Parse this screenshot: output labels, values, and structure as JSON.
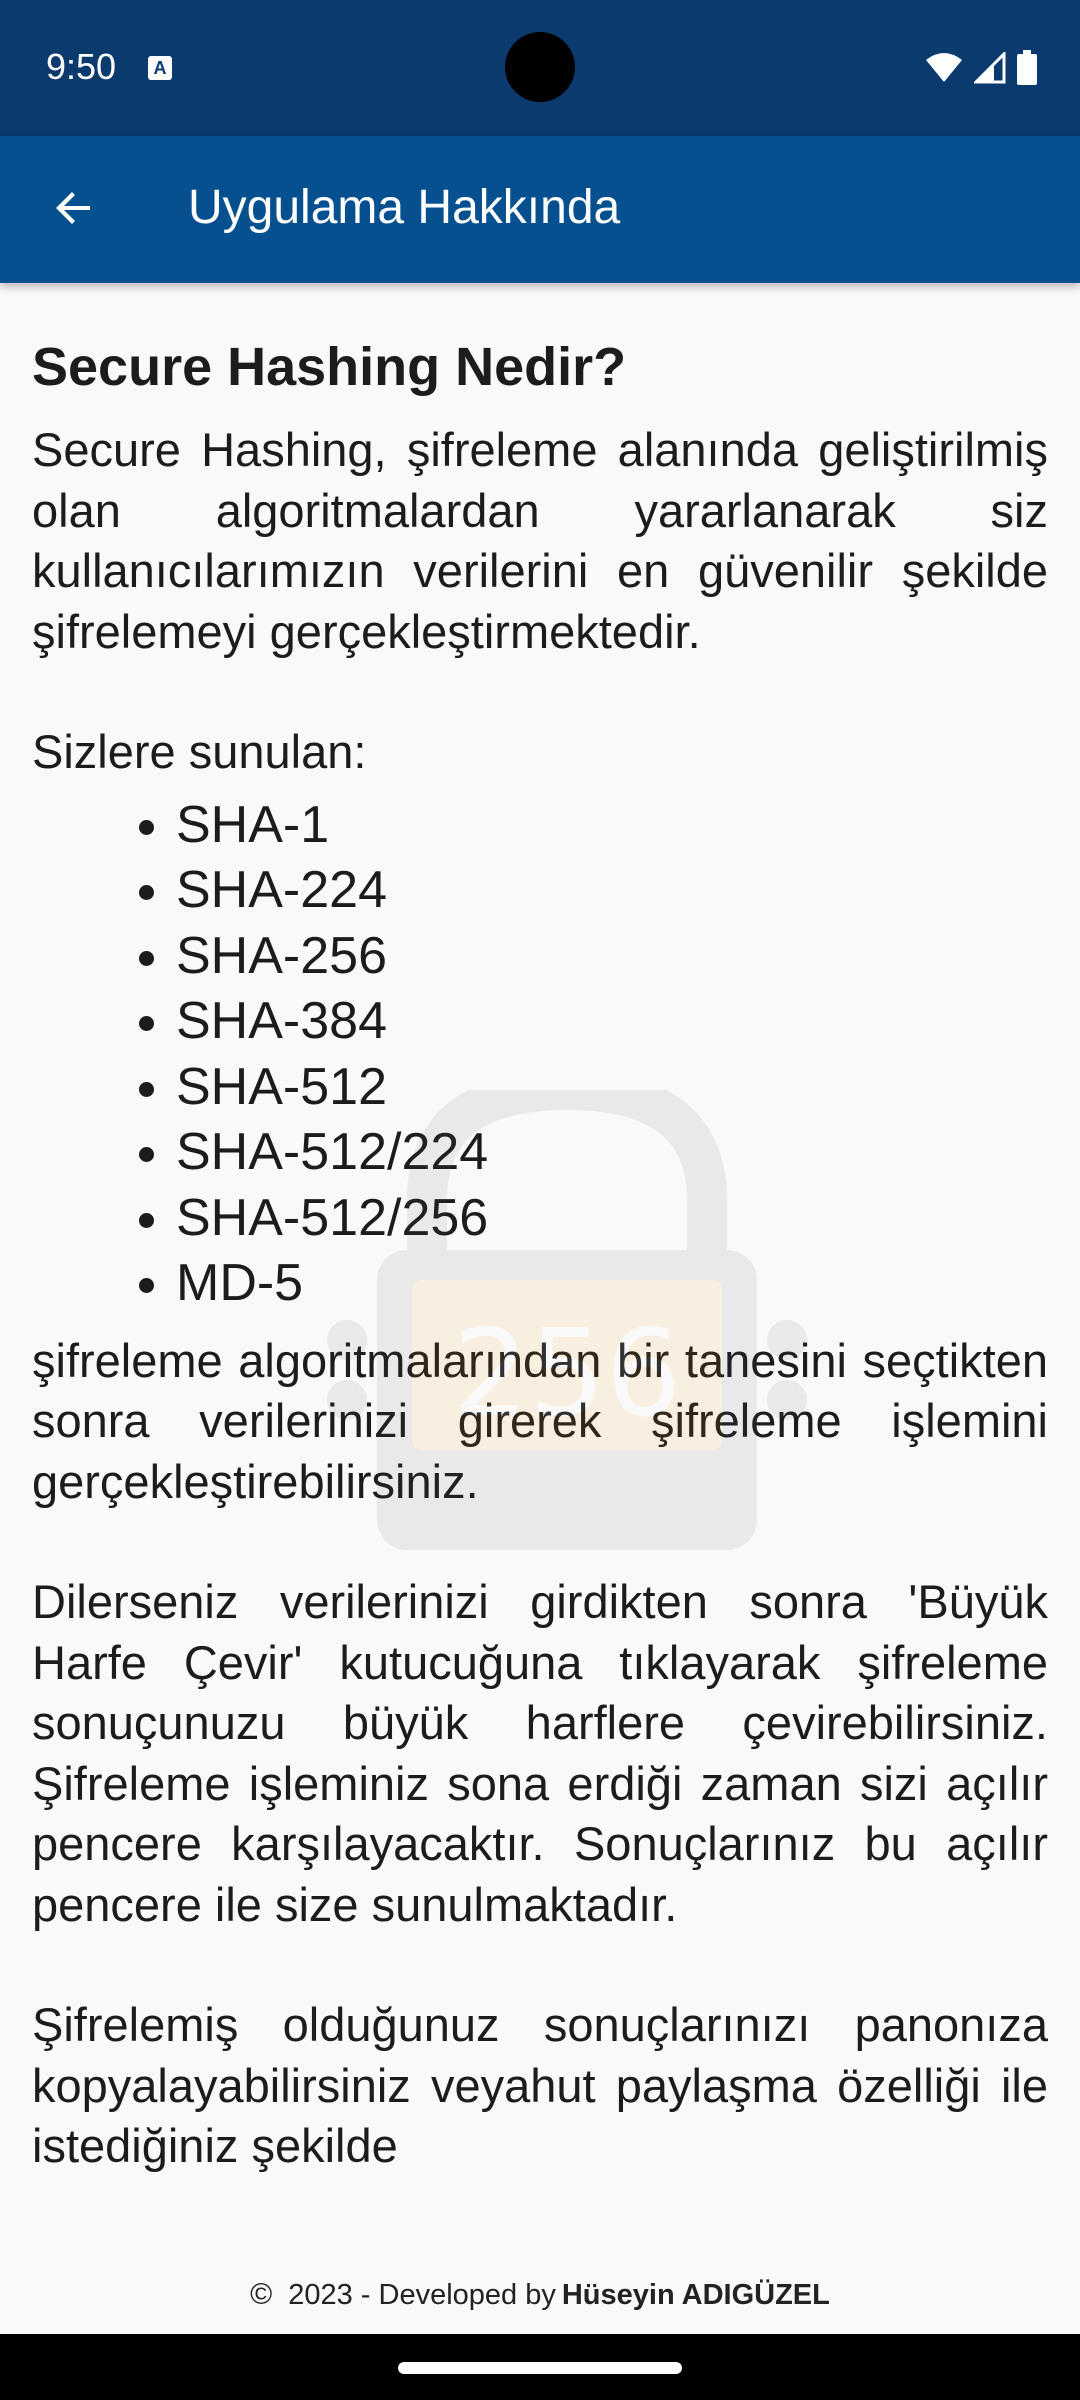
{
  "status_bar": {
    "time": "9:50"
  },
  "app_bar": {
    "title": "Uygulama Hakkında"
  },
  "content": {
    "heading": "Secure Hashing Nedir?",
    "intro": "Secure Hashing, şifreleme alanında geliştirilmiş olan algoritmalardan yararlanarak siz kullanıcılarımızın verilerini en güvenilir şekilde şifrelemeyi gerçekleştirmektedir.",
    "offered_label": "Sizlere sunulan:",
    "algorithms": [
      "SHA-1",
      "SHA-224",
      "SHA-256",
      "SHA-384",
      "SHA-512",
      "SHA-512/224",
      "SHA-512/256",
      "MD-5"
    ],
    "after_list": "şifreleme algoritmalarından bir tanesini seçtikten sonra verilerinizi girerek şifreleme işlemini gerçekleştirebilirsiniz.",
    "uppercase_info": "Dilerseniz verilerinizi girdikten sonra 'Büyük Harfe Çevir' kutucuğuna tıklayarak şifreleme sonuçunuzu büyük harflere çevirebilirsiniz. Şifreleme işleminiz sona erdiği zaman sizi açılır pencere karşılayacaktır. Sonuçlarınız bu açılır pencere ile size sunulmaktadır.",
    "share_info": "Şifrelemiş olduğunuz sonuçlarınızı panonıza kopyalayabilirsiniz veyahut paylaşma özelliği ile istediğiniz şekilde"
  },
  "watermark": {
    "label": "256"
  },
  "footer": {
    "copyright_symbol": "©",
    "text": "2023 - Developed by",
    "author": "Hüseyin ADIGÜZEL"
  }
}
